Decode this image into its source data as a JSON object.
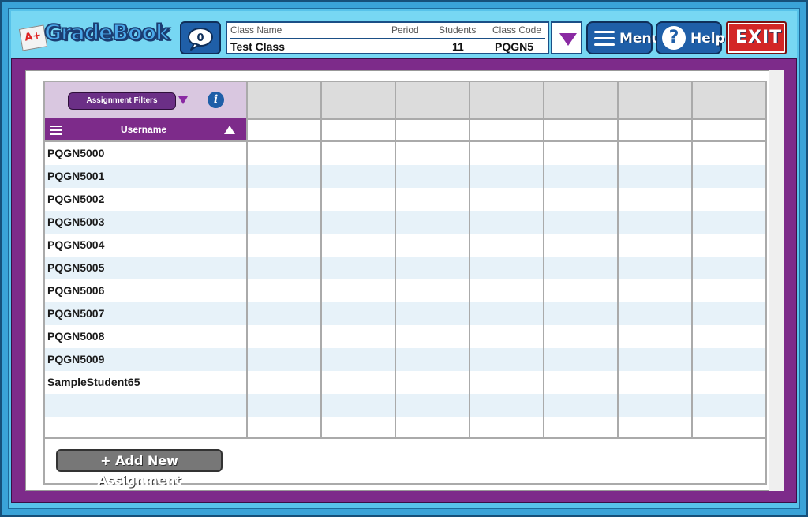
{
  "app": {
    "logo_text": "GradeBook",
    "logo_badge": "A+",
    "message_count": "0"
  },
  "class_info": {
    "headers": {
      "class_name": "Class Name",
      "period": "Period",
      "students": "Students",
      "class_code": "Class Code"
    },
    "values": {
      "class_name": "Test Class",
      "period": "",
      "students": "11",
      "class_code": "PQGN5"
    }
  },
  "toolbar": {
    "menu_label": "Menu",
    "help_label": "Help",
    "exit_label": "EXIT"
  },
  "table": {
    "filter_label": "Assignment Filters",
    "username_header": "Username",
    "assignment_columns": [
      "",
      "",
      "",
      "",
      "",
      "",
      ""
    ],
    "rows": [
      "PQGN5000",
      "PQGN5001",
      "PQGN5002",
      "PQGN5003",
      "PQGN5004",
      "PQGN5005",
      "PQGN5006",
      "PQGN5007",
      "PQGN5008",
      "PQGN5009",
      "SampleStudent65",
      "",
      ""
    ]
  },
  "actions": {
    "add_assignment_label": "+ Add New Assignment"
  },
  "colors": {
    "frame_blue": "#3aa3d8",
    "header_cyan": "#77d7f3",
    "panel_purple": "#7d2b8a",
    "button_blue": "#1f5fa8",
    "exit_red": "#d32626",
    "row_alt": "#e7f2f9"
  }
}
